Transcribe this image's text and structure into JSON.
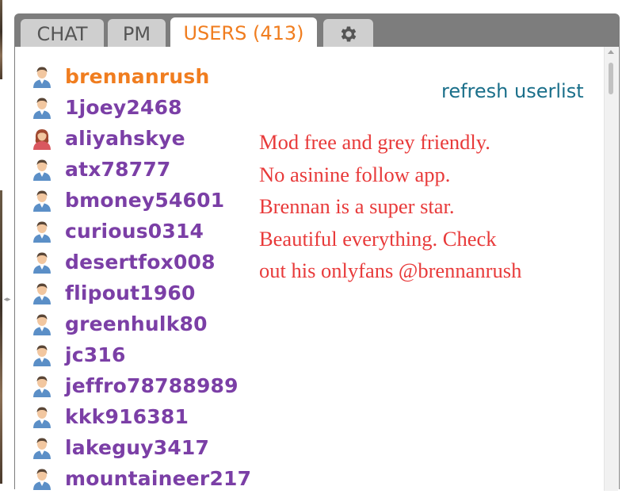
{
  "tabs": [
    {
      "label": "CHAT",
      "active": false
    },
    {
      "label": "PM",
      "active": false
    },
    {
      "label": "USERS (413)",
      "active": true
    },
    {
      "icon": "gear-icon",
      "active": false
    }
  ],
  "users_panel": {
    "refresh_label": "refresh userlist",
    "users": [
      {
        "name": "brennanrush",
        "icon": "male-user-icon",
        "highlight": true
      },
      {
        "name": "1joey2468",
        "icon": "male-user-icon"
      },
      {
        "name": "aliyahskye",
        "icon": "female-user-icon"
      },
      {
        "name": "atx78777",
        "icon": "male-user-icon"
      },
      {
        "name": "bmoney54601",
        "icon": "male-user-icon"
      },
      {
        "name": "curious0314",
        "icon": "male-user-icon"
      },
      {
        "name": "desertfox008",
        "icon": "male-user-icon"
      },
      {
        "name": "flipout1960",
        "icon": "male-user-icon"
      },
      {
        "name": "greenhulk80",
        "icon": "male-user-icon"
      },
      {
        "name": "jc316",
        "icon": "male-user-icon"
      },
      {
        "name": "jeffro78788989",
        "icon": "male-user-icon"
      },
      {
        "name": "kkk916381",
        "icon": "male-user-icon"
      },
      {
        "name": "lakeguy3417",
        "icon": "male-user-icon"
      },
      {
        "name": "mountaineer217",
        "icon": "male-user-icon"
      }
    ],
    "room_subject_lines": [
      "Mod free and grey friendly.",
      "No asinine follow app.",
      "Brennan is a super star.",
      "Beautiful everything. Check",
      "out his onlyfans @brennanrush"
    ]
  },
  "colors": {
    "accent_orange": "#f07d1f",
    "username_purple": "#7b3fa6",
    "subject_red": "#e83a3a",
    "link_blue": "#1a6f8a",
    "tab_bar_gray": "#7d7d7d"
  }
}
